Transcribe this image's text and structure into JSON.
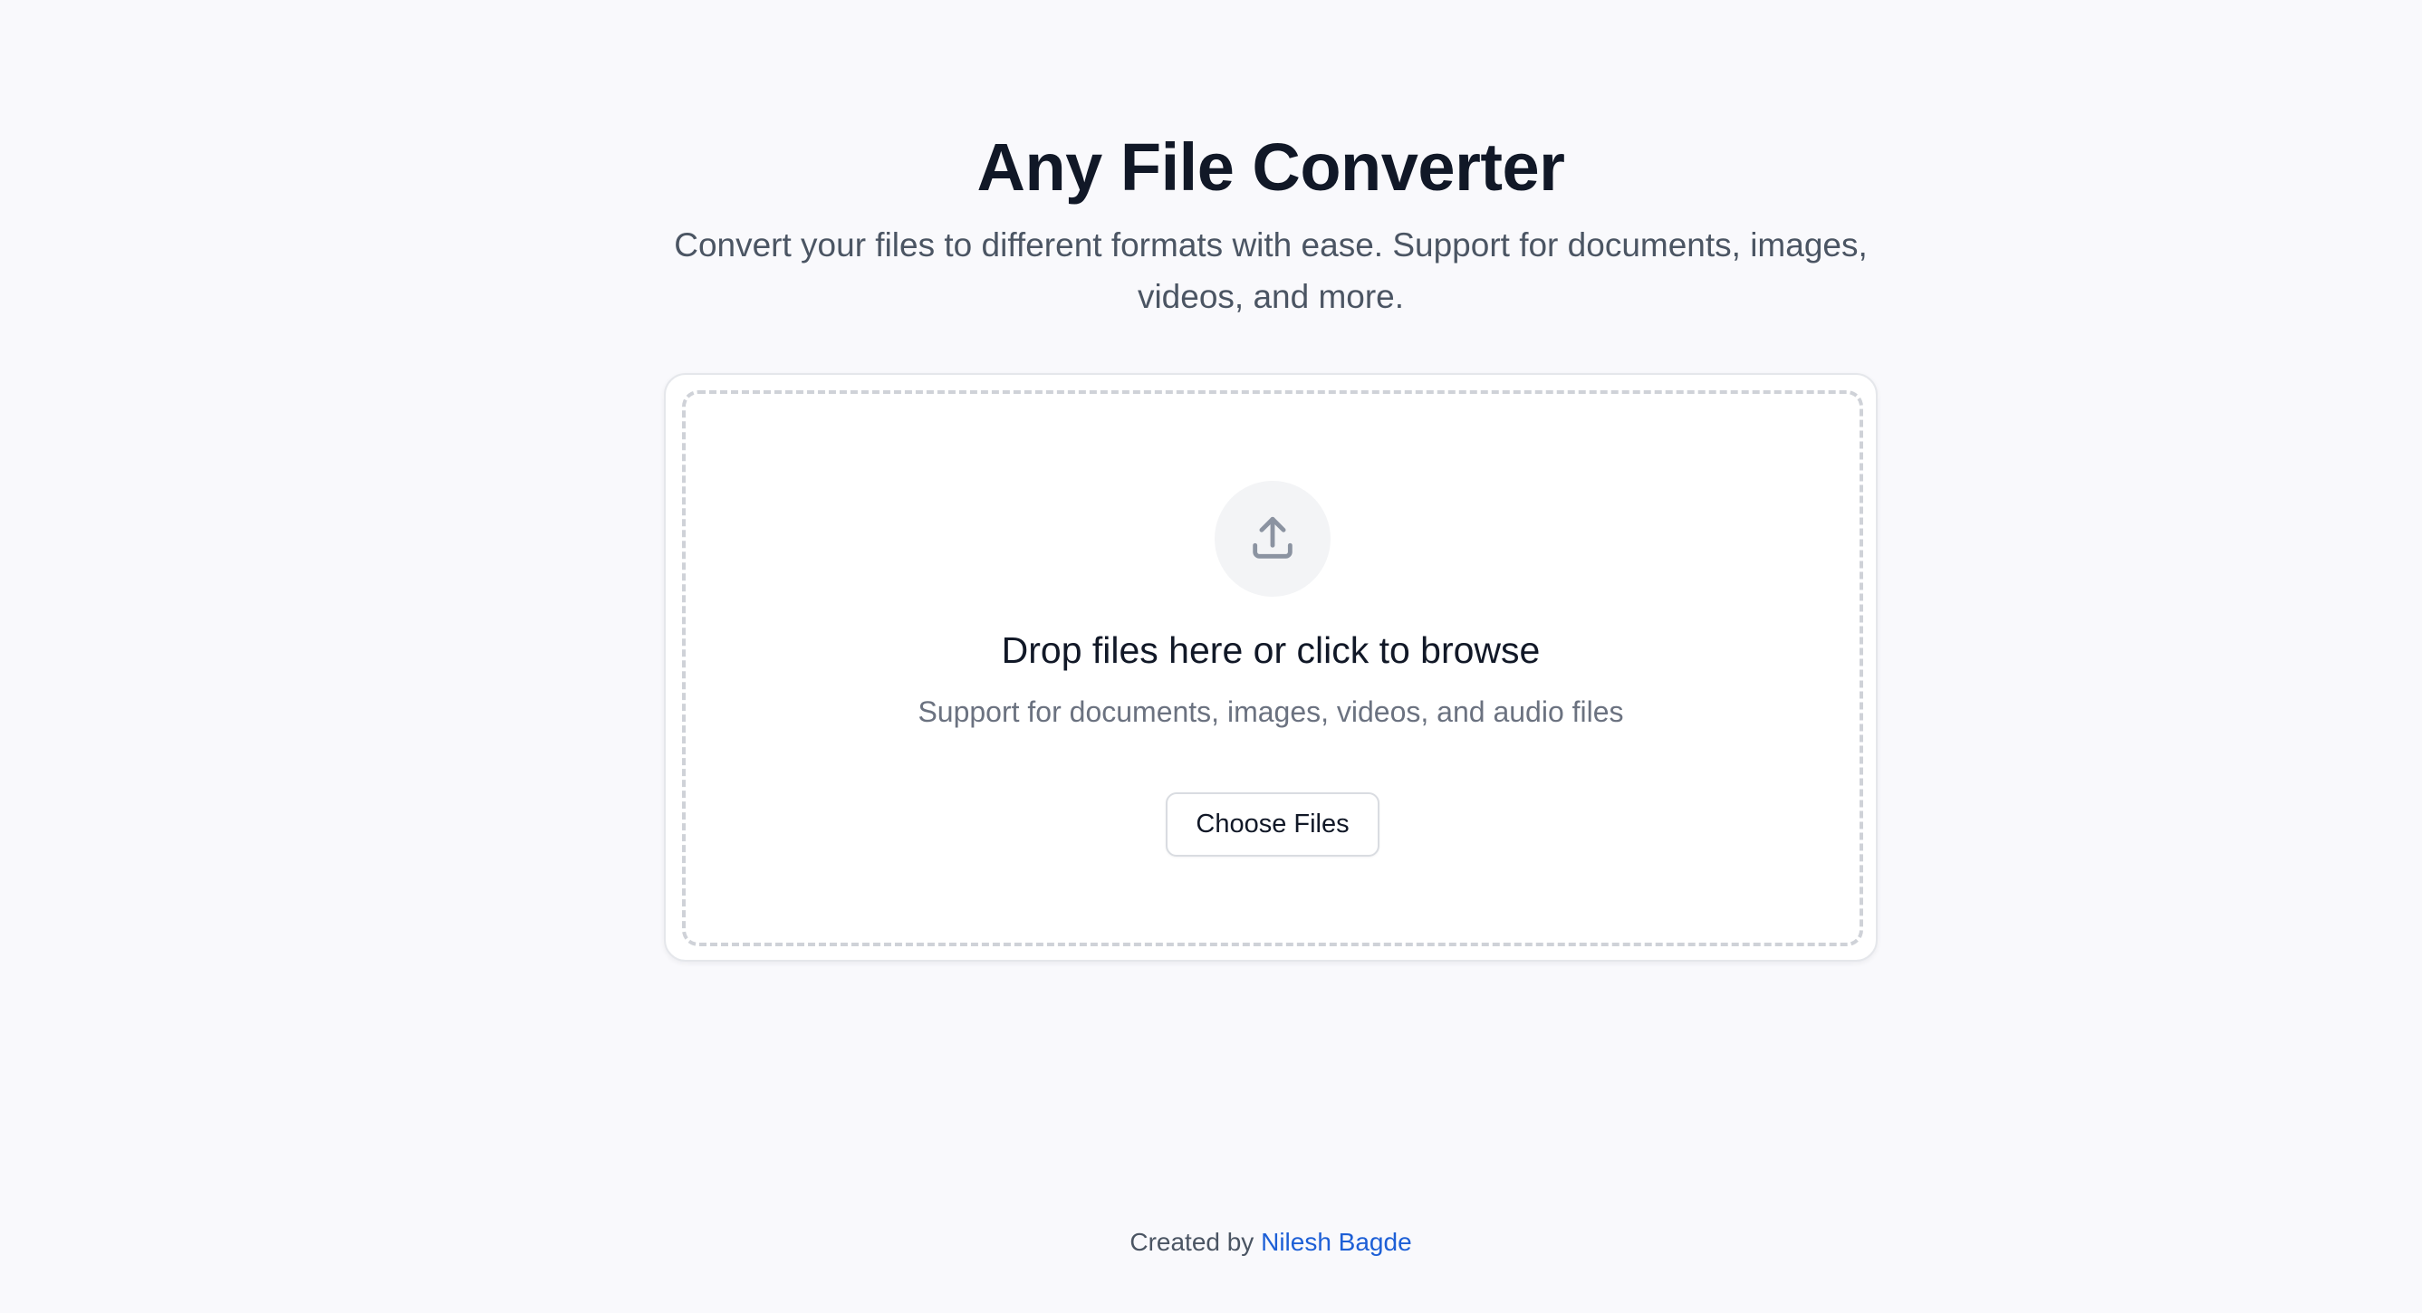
{
  "header": {
    "title": "Any File Converter",
    "subtitle": "Convert your files to different formats with ease. Support for documents, images, videos, and more."
  },
  "upload": {
    "icon": "upload-icon",
    "title": "Drop files here or click to browse",
    "description": "Support for documents, images, videos, and audio files",
    "button_label": "Choose Files"
  },
  "footer": {
    "prefix": "Created by",
    "author": "Nilesh Bagde"
  },
  "colors": {
    "background": "#f9f9fc",
    "title": "#111827",
    "muted_text": "#6b7280",
    "link": "#1d5fd6",
    "icon": "#8b93a1"
  }
}
